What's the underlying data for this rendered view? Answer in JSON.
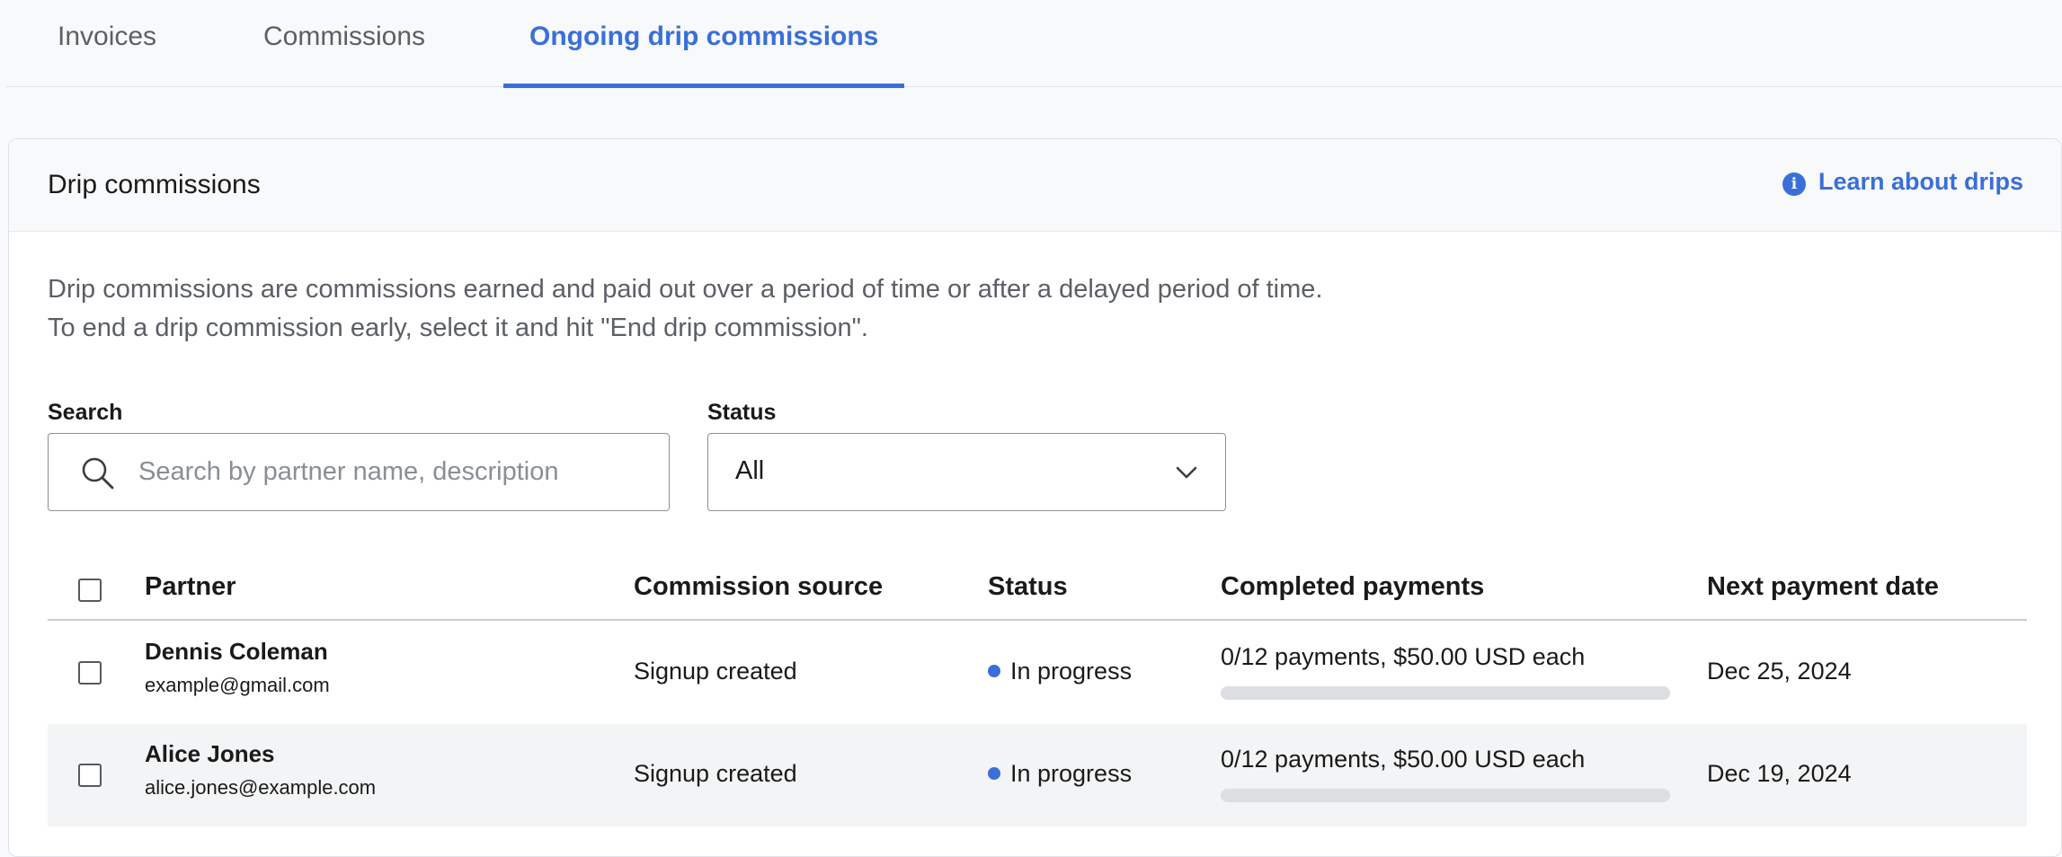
{
  "tabs": [
    {
      "label": "Invoices",
      "active": false
    },
    {
      "label": "Commissions",
      "active": false
    },
    {
      "label": "Ongoing drip commissions",
      "active": true
    }
  ],
  "card": {
    "title": "Drip commissions",
    "learn_link": "Learn about drips",
    "description": "Drip commissions are commissions earned and paid out over a period of time or after a delayed period of time. To end a drip commission early, select it and hit \"End drip commission\"."
  },
  "filters": {
    "search_label": "Search",
    "search_placeholder": "Search by partner name, description",
    "search_value": "",
    "status_label": "Status",
    "status_value": "All"
  },
  "table": {
    "columns": [
      "Partner",
      "Commission source",
      "Status",
      "Completed payments",
      "Next payment date"
    ],
    "rows": [
      {
        "name": "Dennis Coleman",
        "email": "example@gmail.com",
        "source": "Signup created",
        "status": "In progress",
        "payments": "0/12 payments, $50.00 USD each",
        "progress": 0,
        "next_date": "Dec 25, 2024"
      },
      {
        "name": "Alice Jones",
        "email": "alice.jones@example.com",
        "source": "Signup created",
        "status": "In progress",
        "payments": "0/12 payments, $50.00 USD each",
        "progress": 0,
        "next_date": "Dec 19, 2024"
      }
    ]
  },
  "colors": {
    "accent": "#3a6fd8",
    "status_in_progress": "#3a6fd8"
  }
}
